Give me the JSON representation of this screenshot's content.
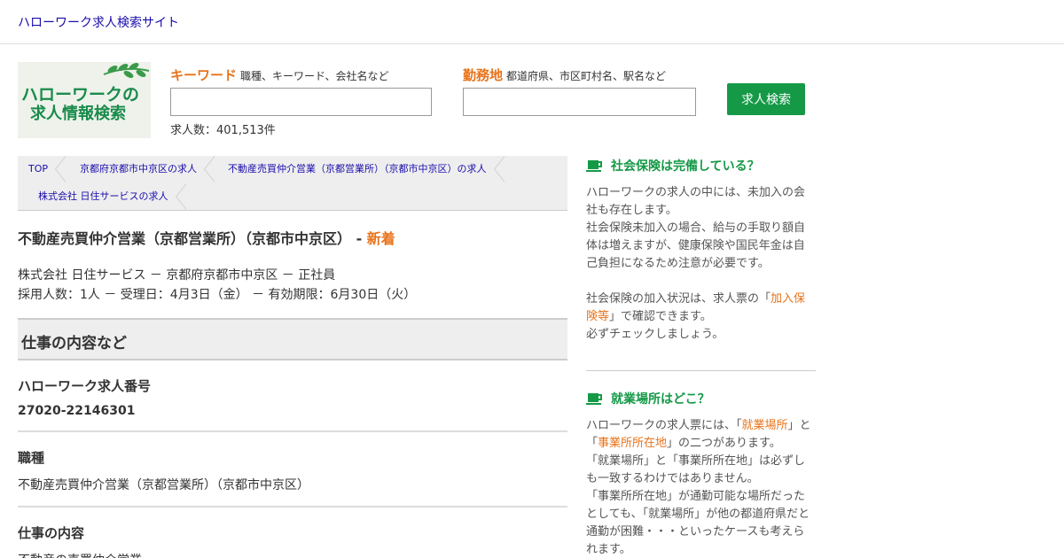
{
  "site_title": "ハローワーク求人検索サイト",
  "logo": {
    "line1": "ハローワークの",
    "line2": "求人情報検索"
  },
  "search": {
    "keyword_label": "キーワード",
    "keyword_hint": "職種、キーワード、会社名など",
    "keyword_value": "",
    "location_label": "勤務地",
    "location_hint": "都道府県、市区町村名、駅名など",
    "location_value": "",
    "button_label": "求人検索",
    "count_text": "求人数：401,513件"
  },
  "breadcrumbs": [
    "TOP",
    "京都府京都市中京区の求人",
    "不動産売買仲介営業（京都営業所）（京都市中京区）の求人",
    "株式会社 日住サービスの求人"
  ],
  "job": {
    "title": "不動産売買仲介営業（京都営業所）（京都市中京区）",
    "separator": " - ",
    "new_label": "新着",
    "meta_line1": "株式会社 日住サービス － 京都府京都市中京区 － 正社員",
    "meta_line2": "採用人数：1人 － 受理日：4月3日（金） － 有効期限：6月30日（火）"
  },
  "section_title": "仕事の内容など",
  "items": [
    {
      "key": "ハローワーク求人番号",
      "value": "27020-22146301"
    },
    {
      "key": "職種",
      "value": "不動産売買仲介営業（京都営業所）（京都市中京区）"
    },
    {
      "key": "仕事の内容",
      "value": "不動産の売買仲介営業"
    }
  ],
  "sidebar": {
    "box1": {
      "title": "社会保険は完備している？",
      "p1": "ハローワークの求人の中には、未加入の会社も存在します。",
      "p2": "社会保険未加入の場合、給与の手取り額自体は増えますが、健康保険や国民年金は自己負担になるため注意が必要です。",
      "p3_a": "社会保険の加入状況は、求人票の「",
      "p3_link": "加入保険等",
      "p3_b": "」で確認できます。",
      "p3_c": "必ずチェックしましょう。"
    },
    "box2": {
      "title": "就業場所はどこ？",
      "p1_a": "ハローワークの求人票には、「",
      "p1_link1": "就業場所",
      "p1_b": "」と「",
      "p1_link2": "事業所所在地",
      "p1_c": "」の二つがあります。",
      "p2": "「就業場所」と「事業所所在地」は必ずしも一致するわけではありません。",
      "p3": "「事業所所在地」が通勤可能な場所だったとしても、「就業場所」が他の都道府県だと通勤が困難・・・といったケースも考えられます。"
    }
  },
  "colors": {
    "accent_green": "#159947",
    "accent_orange": "#e8731b",
    "link": "#1a0dab"
  }
}
